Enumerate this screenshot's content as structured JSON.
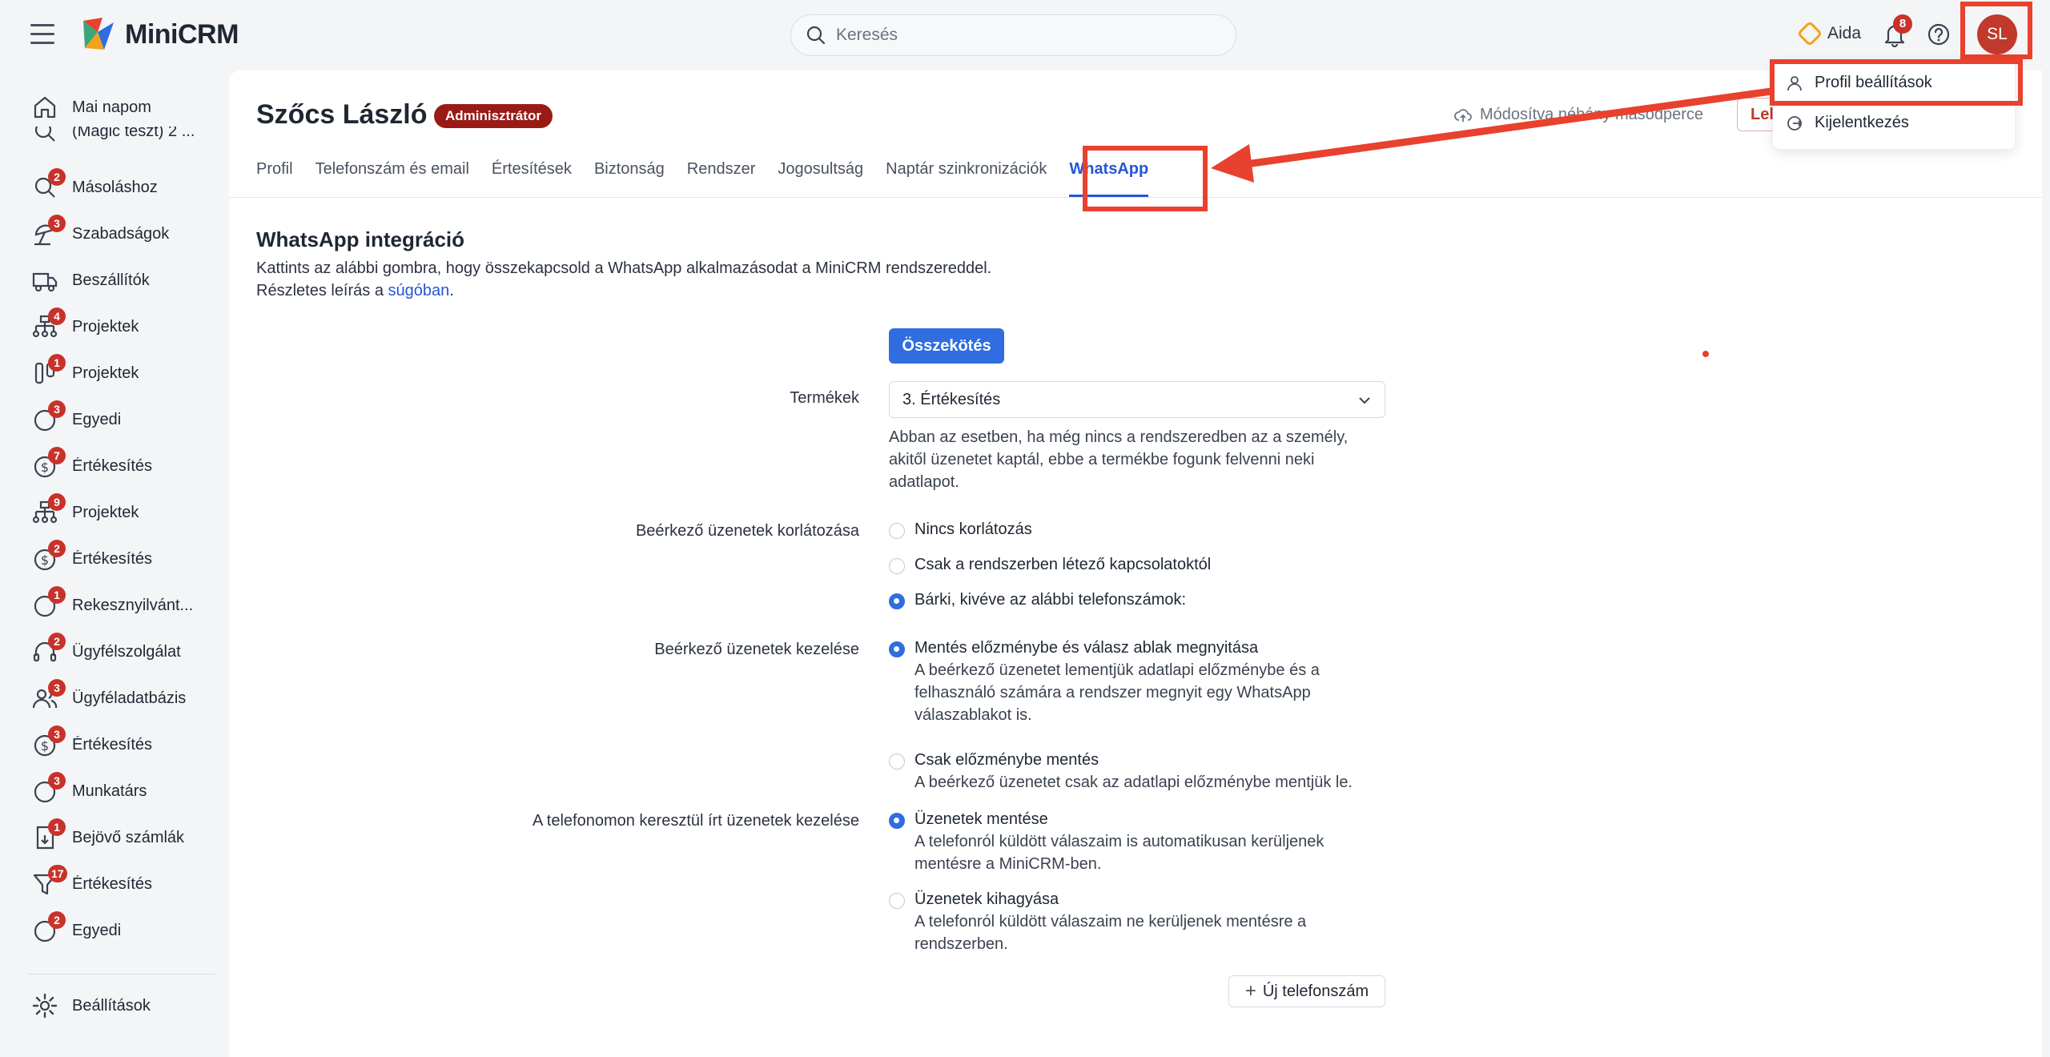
{
  "app": {
    "name": "MiniCRM"
  },
  "search": {
    "placeholder": "Keresés"
  },
  "header": {
    "aida_label": "Aida",
    "notification_count": "8",
    "avatar_initials": "SL"
  },
  "user_menu": {
    "items": [
      {
        "label": "Profil beállítások"
      },
      {
        "label": "Kijelentkezés"
      }
    ]
  },
  "sidebar": {
    "items": [
      {
        "label": "Mai napom",
        "badge": ""
      },
      {
        "label": "(Magic teszt) 2 ...",
        "badge": ""
      },
      {
        "label": "Másoláshoz",
        "badge": "2"
      },
      {
        "label": "Szabadságok",
        "badge": "3"
      },
      {
        "label": "Beszállítók",
        "badge": ""
      },
      {
        "label": "Projektek",
        "badge": "4"
      },
      {
        "label": "Projektek",
        "badge": "1"
      },
      {
        "label": "Egyedi",
        "badge": "3"
      },
      {
        "label": "Értékesítés",
        "badge": "7"
      },
      {
        "label": "Projektek",
        "badge": "9"
      },
      {
        "label": "Értékesítés",
        "badge": "2"
      },
      {
        "label": "Rekesznyilvánt...",
        "badge": "1"
      },
      {
        "label": "Ügyfélszolgálat",
        "badge": "2"
      },
      {
        "label": "Ügyféladatbázis",
        "badge": "3"
      },
      {
        "label": "Értékesítés",
        "badge": "3"
      },
      {
        "label": "Munkatárs",
        "badge": "3"
      },
      {
        "label": "Bejövő számlák",
        "badge": "1"
      },
      {
        "label": "Értékesítés",
        "badge": "17"
      },
      {
        "label": "Egyedi",
        "badge": "2"
      }
    ],
    "settings_label": "Beállítások"
  },
  "page": {
    "title": "Szőcs László",
    "role_badge": "Adminisztrátor",
    "modified_text": "Módosítva néhány másodperce",
    "red_button_label": "Lel",
    "tabs": [
      {
        "label": "Profil"
      },
      {
        "label": "Telefonszám és email"
      },
      {
        "label": "Értesítések"
      },
      {
        "label": "Biztonság"
      },
      {
        "label": "Rendszer"
      },
      {
        "label": "Jogosultság"
      },
      {
        "label": "Naptár szinkronizációk"
      },
      {
        "label": "WhatsApp"
      }
    ],
    "active_tab": "WhatsApp"
  },
  "whatsapp": {
    "title": "WhatsApp integráció",
    "description": "Kattints az alábbi gombra, hogy összekapcsold a WhatsApp alkalmazásodat a MiniCRM rendszereddel.",
    "help_prefix": "Részletes leírás a ",
    "help_link": "súgóban",
    "help_suffix": ".",
    "connect_button": "Összekötés",
    "products": {
      "label": "Termékek",
      "value": "3. Értékesítés",
      "help": "Abban az esetben, ha még nincs a rendszeredben az a személy, akitől üzenetet kaptál, ebbe a termékbe fogunk felvenni neki adatlapot."
    },
    "incoming_limit": {
      "label": "Beérkező üzenetek korlátozása",
      "options": [
        {
          "label": "Nincs korlátozás",
          "checked": false
        },
        {
          "label": "Csak a rendszerben létező kapcsolatoktól",
          "checked": false
        },
        {
          "label": "Bárki, kivéve az alábbi telefonszámok:",
          "checked": true
        }
      ]
    },
    "incoming_handling": {
      "label": "Beérkező üzenetek kezelése",
      "options": [
        {
          "label": "Mentés előzménybe és válasz ablak megnyitása",
          "desc": "A beérkező üzenetet lementjük adatlapi előzménybe és a felhasználó számára a rendszer megnyit egy WhatsApp válaszablakot is.",
          "checked": true
        },
        {
          "label": "Csak előzménybe mentés",
          "desc": "A beérkező üzenetet csak az adatlapi előzménybe mentjük le.",
          "checked": false
        }
      ]
    },
    "phone_handling": {
      "label": "A telefonomon keresztül írt üzenetek kezelése",
      "options": [
        {
          "label": "Üzenetek mentése",
          "desc": "A telefonról küldött válaszaim is automatikusan kerüljenek mentésre a MiniCRM-ben.",
          "checked": true
        },
        {
          "label": "Üzenetek kihagyása",
          "desc": "A telefonról küldött válaszaim ne kerüljenek mentésre a rendszerben.",
          "checked": false
        }
      ]
    },
    "new_phone_button": "Új telefonszám"
  },
  "colors": {
    "accent": "#2f6de0",
    "annotation": "#e8412d",
    "badge": "#c8322a",
    "role_badge": "#9a1b16"
  }
}
